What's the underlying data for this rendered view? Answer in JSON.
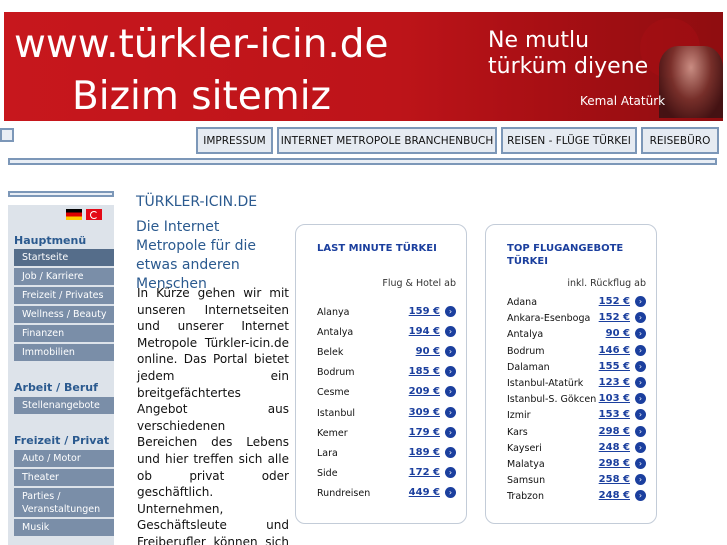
{
  "banner": {
    "url": "www.türkler-icin.de",
    "subtitle": "Bizim sitemiz",
    "quote_line1": "Ne mutlu",
    "quote_line2": "türküm diyene",
    "quote_author": "Kemal Atatürk"
  },
  "nav": {
    "items": [
      "IMPRESSUM",
      "INTERNET METROPOLE BRANCHENBUCH",
      "REISEN - FLÜGE TÜRKEI",
      "REISEBÜRO"
    ]
  },
  "sidebar": {
    "section1": "Hauptmenü",
    "items1": [
      "Startseite",
      "Job / Karriere",
      "Freizeit / Privates",
      "Wellness / Beauty",
      "Finanzen",
      "Immobilien"
    ],
    "section2": "Arbeit / Beruf",
    "items2": [
      "Stellenangebote"
    ],
    "section3": "Freizeit / Privat",
    "items3": [
      "Auto / Motor",
      "Theater",
      "Parties / Veranstaltungen",
      "Musik"
    ]
  },
  "main": {
    "title": "TÜRKLER-ICIN.DE",
    "tagline": "Die Internet Metropole für die etwas anderen Menschen",
    "body": "In Kürze gehen wir mit unseren Internetseiten und unserer Internet Metropole Türkler-icin.de online. Das Portal bietet jedem ein breitgefächtertes Angebot aus verschiedenen Bereichen des Lebens und hier treffen sich alle ob privat oder geschäftlich. Unternehmen, Geschäftsleute und Freiberufler können sich in userem Türkisch"
  },
  "lastminute": {
    "title": "LAST MINUTE TÜRKEI",
    "note": "Flug & Hotel ab",
    "rows": [
      {
        "city": "Alanya",
        "price": "159 €"
      },
      {
        "city": "Antalya",
        "price": "194 €"
      },
      {
        "city": "Belek",
        "price": "90 €"
      },
      {
        "city": "Bodrum",
        "price": "185 €"
      },
      {
        "city": "Cesme",
        "price": "209 €"
      },
      {
        "city": "Istanbul",
        "price": "309 €"
      },
      {
        "city": "Kemer",
        "price": "179 €"
      },
      {
        "city": "Lara",
        "price": "189 €"
      },
      {
        "city": "Side",
        "price": "172 €"
      },
      {
        "city": "Rundreisen",
        "price": "449 €"
      }
    ]
  },
  "flights": {
    "title": "TOP FLUGANGEBOTE TÜRKEI",
    "note": "inkl. Rückflug ab",
    "rows": [
      {
        "city": "Adana",
        "price": "152 €"
      },
      {
        "city": "Ankara-Esenboga",
        "price": "152 €"
      },
      {
        "city": "Antalya",
        "price": "90 €"
      },
      {
        "city": "Bodrum",
        "price": "146 €"
      },
      {
        "city": "Dalaman",
        "price": "155 €"
      },
      {
        "city": "Istanbul-Atatürk",
        "price": "123 €"
      },
      {
        "city": "Istanbul-S. Gökcen",
        "price": "103 €"
      },
      {
        "city": "Izmir",
        "price": "153 €"
      },
      {
        "city": "Kars",
        "price": "298 €"
      },
      {
        "city": "Kayseri",
        "price": "248 €"
      },
      {
        "city": "Malatya",
        "price": "298 €"
      },
      {
        "city": "Samsun",
        "price": "258 €"
      },
      {
        "city": "Trabzon",
        "price": "248 €"
      }
    ]
  },
  "icons": {
    "arrow": "arrow-right-circle-icon",
    "flag_de": "german-flag-icon",
    "flag_tr": "turkish-flag-icon"
  },
  "colors": {
    "banner_red": "#c7171d",
    "link_blue": "#1b3f9e",
    "heading_blue": "#2b5a8f",
    "sidebar_item": "#7a8ea8"
  }
}
